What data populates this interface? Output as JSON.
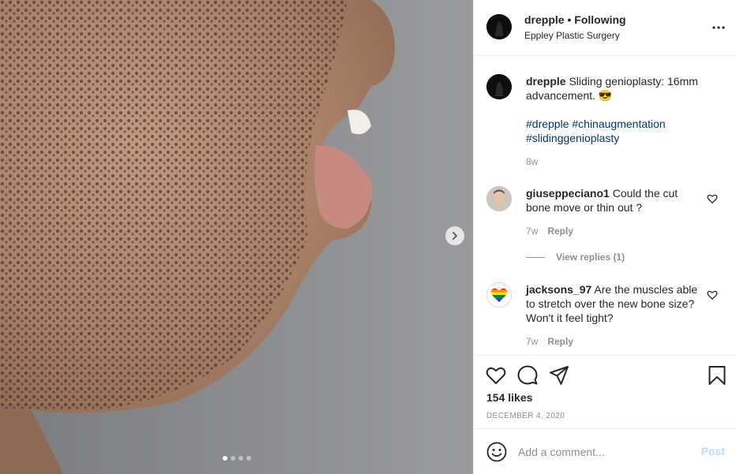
{
  "post": {
    "username": "drepple",
    "separator": "•",
    "follow_status": "Following",
    "location": "Eppley Plastic Surgery"
  },
  "caption": {
    "username": "drepple",
    "text": "Sliding genioplasty: 16mm advancement. 😎",
    "hashtags": "#drepple #chinaugmentation #slidinggenioplasty",
    "time": "8w"
  },
  "comments": [
    {
      "username": "giuseppeciano1",
      "text": "Could the cut bone move or thin out ?",
      "time": "7w",
      "reply_label": "Reply",
      "view_replies": "View replies (1)"
    },
    {
      "username": "jacksons_97",
      "text": "Are the muscles able to stretch over the new bone size? Won't it feel tight?",
      "time": "7w",
      "reply_label": "Reply"
    }
  ],
  "stats": {
    "likes": "154 likes",
    "date": "DECEMBER 4, 2020"
  },
  "add_comment": {
    "placeholder": "Add a comment...",
    "post_label": "Post"
  },
  "carousel": {
    "dot_count": 4,
    "active_index": 0
  },
  "colors": {
    "link": "#00376b",
    "muted": "#8e8e8e",
    "post_disabled": "#b2dffc",
    "border": "#efefef"
  },
  "icons": [
    "chevron-right-icon",
    "more-icon",
    "heart-icon",
    "comment-icon",
    "share-icon",
    "bookmark-icon",
    "emoji-icon"
  ]
}
